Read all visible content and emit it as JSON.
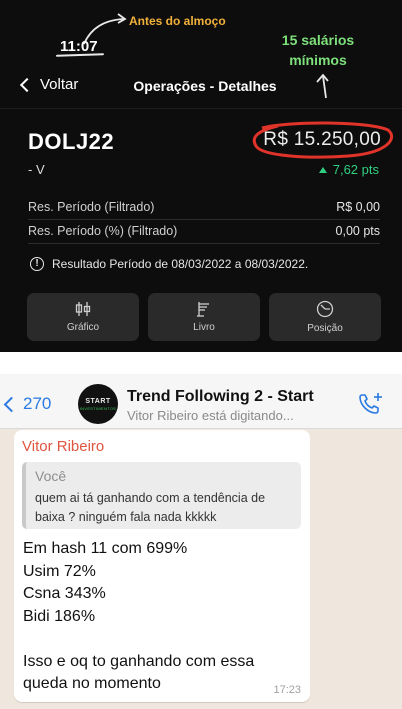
{
  "trading": {
    "clock": "11:07",
    "annotation_lunch": "Antes do almoço",
    "annotation_salaries_line1": "15 salários",
    "annotation_salaries_line2": "mínimos",
    "back_label": "Voltar",
    "title": "Operações - Detalhes",
    "ticker": "DOLJ22",
    "side": "- V",
    "price": "R$ 15.250,00",
    "points": "7,62 pts",
    "rows": [
      {
        "label": "Res. Período (Filtrado)",
        "value": "R$ 0,00"
      },
      {
        "label": "Res. Período (%) (Filtrado)",
        "value": "0,00 pts"
      }
    ],
    "info_text": "Resultado Período de 08/03/2022 a 08/03/2022.",
    "actions": [
      {
        "label": "Gráfico",
        "icon": "candlestick-icon"
      },
      {
        "label": "Livro",
        "icon": "book-icon"
      },
      {
        "label": "Posição",
        "icon": "position-icon"
      }
    ],
    "colors": {
      "profit_green": "#2fd07f",
      "annotation_orange": "#f2b13a",
      "annotation_green": "#7de07a",
      "circle_red": "#e0332a"
    }
  },
  "whatsapp": {
    "back_count": "270",
    "avatar_line1": "START",
    "avatar_line2": "INVESTIMENTOS",
    "group_title": "Trend Following 2 - Start",
    "typing_status": "Vitor Ribeiro está digitando...",
    "message": {
      "sender": "Vitor Ribeiro",
      "quoted_author": "Você",
      "quoted_text": "quem ai tá ganhando com a tendência de baixa ? ninguém fala nada kkkkk",
      "lines": [
        "Em hash 11 com 699%",
        "Usim 72%",
        "Csna 343%",
        "Bidi 186%"
      ],
      "closing": [
        "Isso e oq to ganhando com essa",
        "queda no momento"
      ],
      "time": "17:23"
    },
    "colors": {
      "link_blue": "#2a7ae2",
      "sender_red": "#e0553f",
      "chat_bg": "#efe7dd"
    }
  }
}
